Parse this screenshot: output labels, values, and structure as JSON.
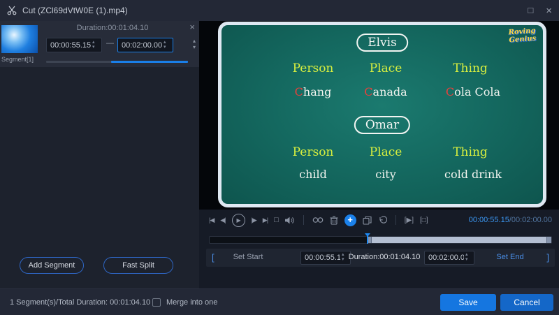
{
  "glyphs": {
    "maximize": "□",
    "close": "×",
    "up": "▴",
    "down": "▾"
  },
  "titlebar": {
    "title": "Cut (ZCl69dVtW0E (1).mp4)"
  },
  "segment_panel": {
    "duration_label": "Duration:00:01:04.10",
    "start_value": "00:00:55.15",
    "range_dash": "—",
    "end_value": "00:02:00.00",
    "segment_label": "Segment[1]",
    "add_segment_label": "Add Segment",
    "fast_split_label": "Fast Split"
  },
  "video": {
    "logo_line1": "Roving",
    "logo_line2": "Genius",
    "sections": [
      {
        "title": "Elvis",
        "headers": [
          "Person",
          "Place",
          "Thing"
        ],
        "values": [
          {
            "lead": "C",
            "rest": "hang"
          },
          {
            "lead": "C",
            "rest": "anada"
          },
          {
            "lead": "C",
            "rest": "ola Cola"
          }
        ]
      },
      {
        "title": "Omar",
        "headers": [
          "Person",
          "Place",
          "Thing"
        ],
        "values": [
          {
            "lead": "",
            "rest": "child"
          },
          {
            "lead": "",
            "rest": "city"
          },
          {
            "lead": "",
            "rest": "cold drink"
          }
        ]
      }
    ]
  },
  "player": {
    "glyph_skip_start": "|◀",
    "glyph_step_back": "◀|",
    "glyph_play": "▶",
    "glyph_step_fwd": "|▶",
    "glyph_skip_end": "▶|",
    "glyph_stop": "□",
    "glyph_segment_play": "[▶]",
    "glyph_segment_stop": "[□]",
    "current_time": "00:00:55.15",
    "total_time": "/00:02:00.00"
  },
  "timeline": {
    "selection_start_pct": 46
  },
  "trim": {
    "bracket_left": "[",
    "set_start_label": "Set Start",
    "start_value": "00:00:55.15",
    "duration_label": "Duration:00:01:04.10",
    "end_value": "00:02:00.00",
    "set_end_label": "Set End",
    "bracket_right": "]"
  },
  "footer": {
    "summary": "1 Segment(s)/Total Duration: 00:01:04.10",
    "merge_label": "Merge into one",
    "save_label": "Save",
    "cancel_label": "Cancel"
  }
}
